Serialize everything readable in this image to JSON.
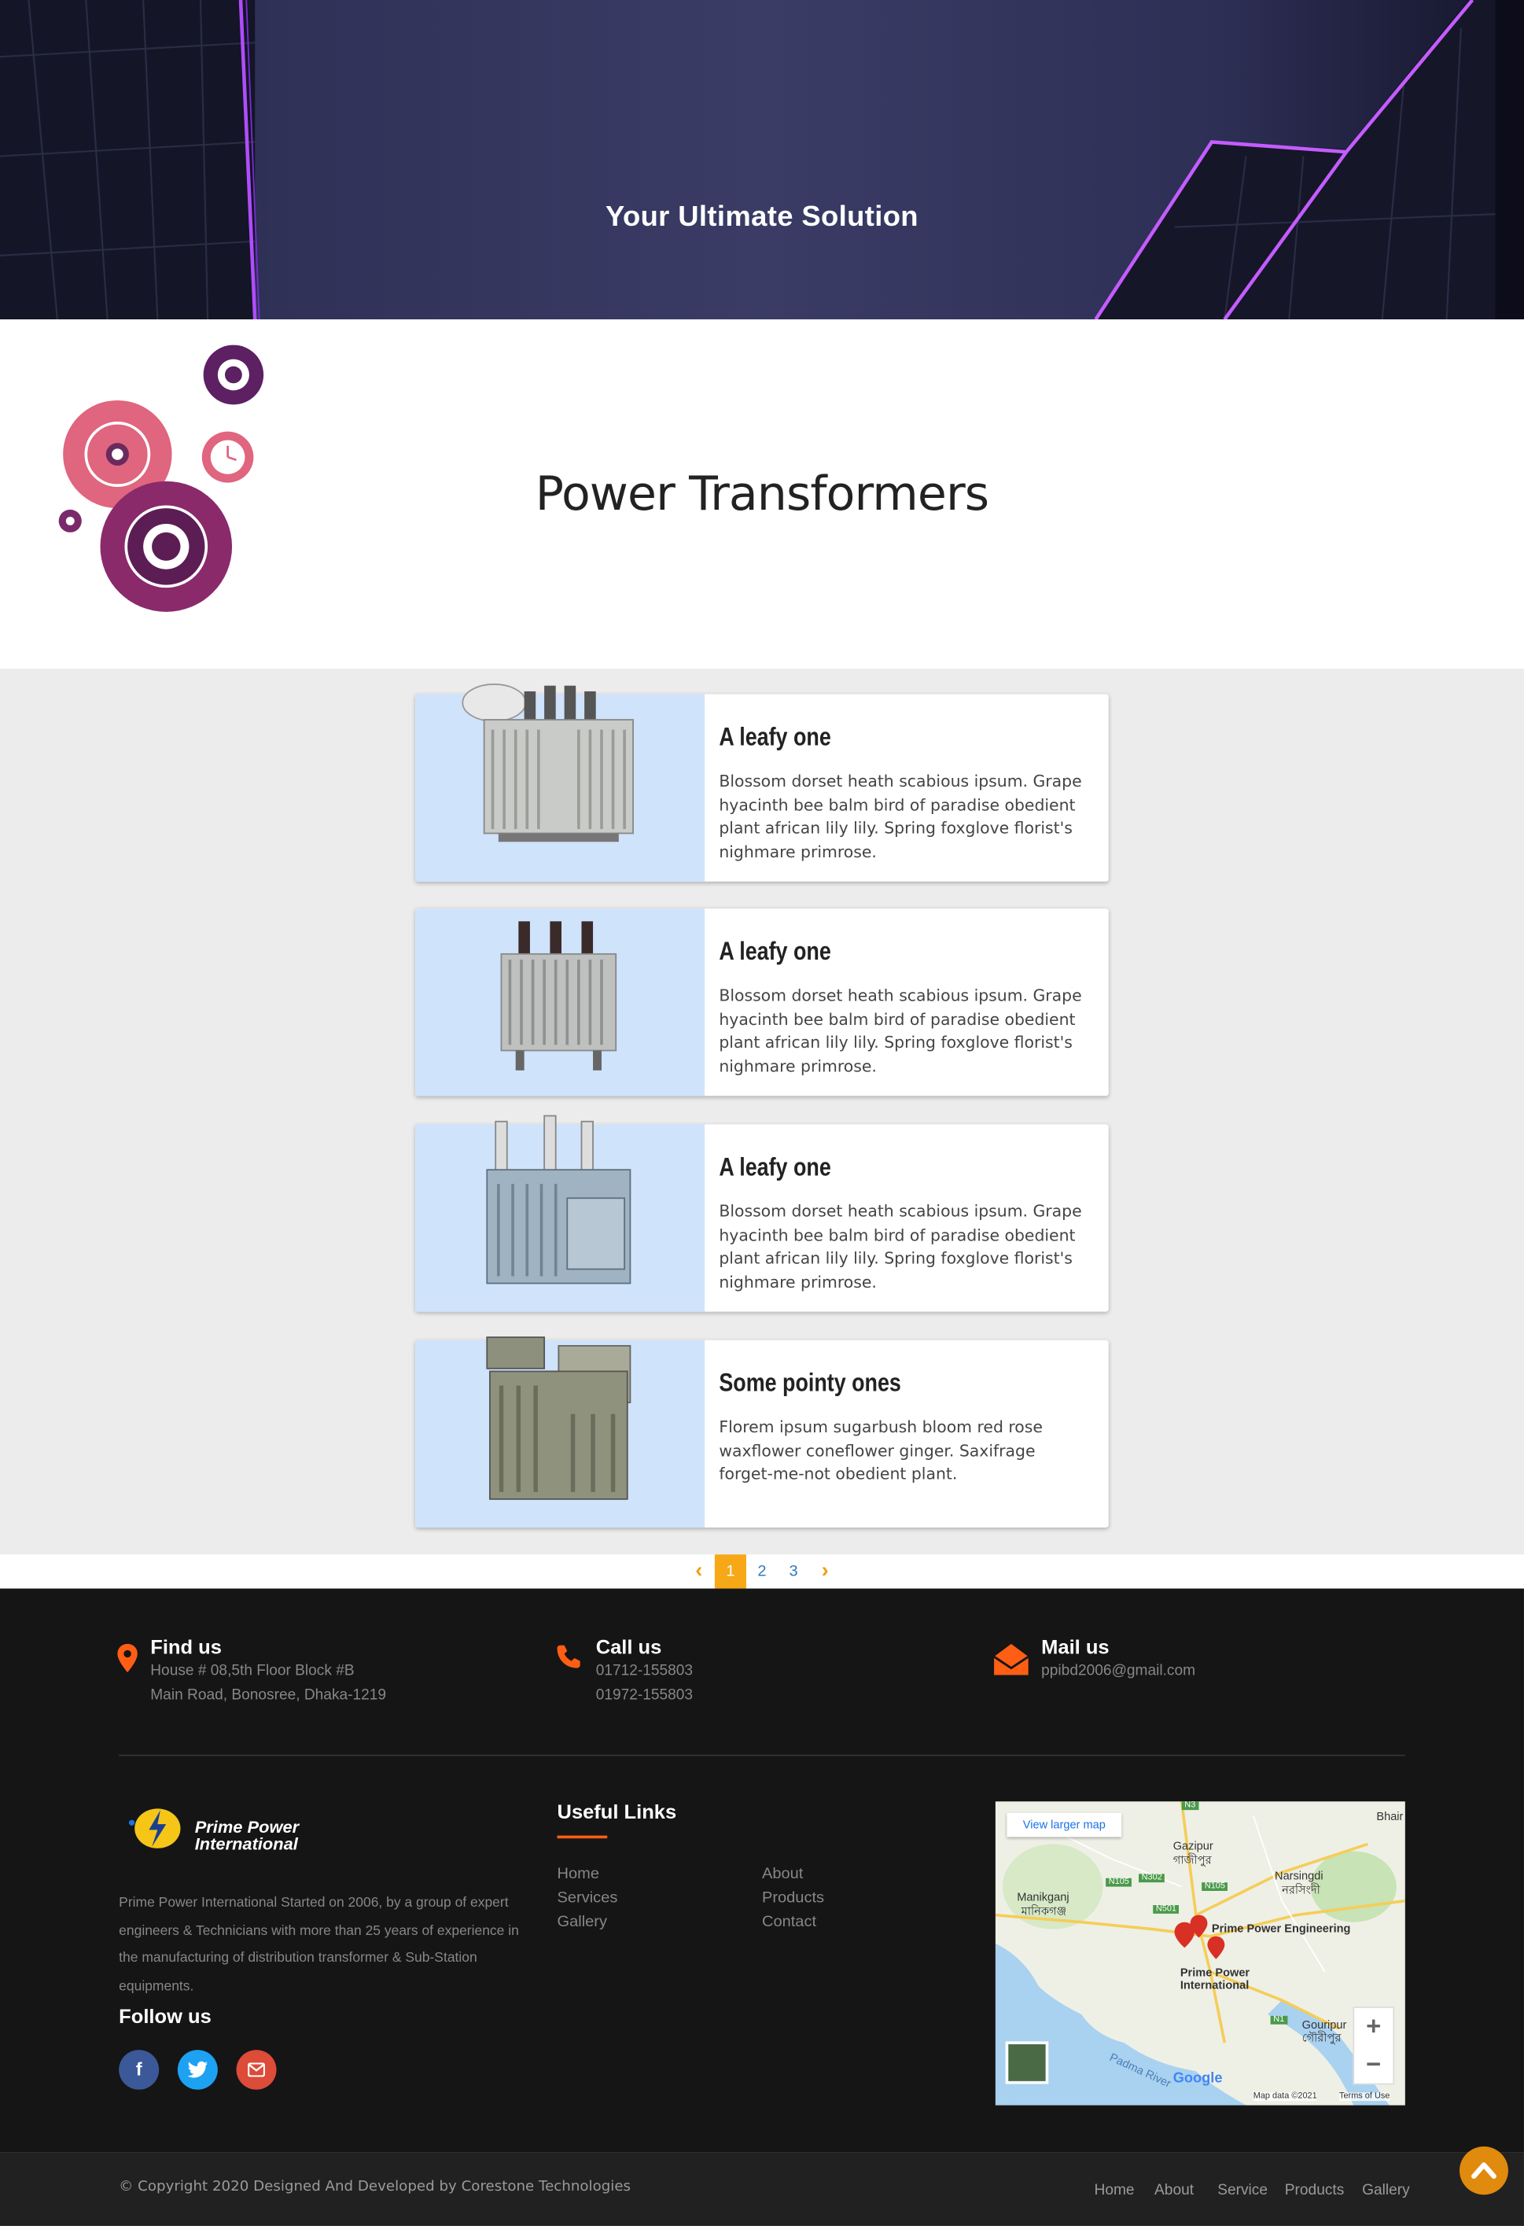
{
  "hero": {
    "title": "Your Ultimate Solution"
  },
  "page": {
    "title": "Power Transformers"
  },
  "products": [
    {
      "title": "A leafy one",
      "text": "Blossom dorset heath scabious ipsum. Grape hyacinth bee balm bird of paradise obedient plant african lily lily. Spring foxglove florist's nighmare primrose."
    },
    {
      "title": "A leafy one",
      "text": "Blossom dorset heath scabious ipsum. Grape hyacinth bee balm bird of paradise obedient plant african lily lily. Spring foxglove florist's nighmare primrose."
    },
    {
      "title": "A leafy one",
      "text": "Blossom dorset heath scabious ipsum. Grape hyacinth bee balm bird of paradise obedient plant african lily lily. Spring foxglove florist's nighmare primrose."
    },
    {
      "title": "Some pointy ones",
      "text": "Florem ipsum sugarbush bloom red rose waxflower coneflower ginger. Saxifrage forget-me-not obedient plant."
    }
  ],
  "pagination": {
    "prev": "‹",
    "pages": [
      "1",
      "2",
      "3"
    ],
    "next": "›",
    "current": "1"
  },
  "contact": {
    "find": {
      "title": "Find us",
      "line1": "House # 08,5th Floor Block #B",
      "line2": "Main Road, Bonosree, Dhaka-1219"
    },
    "call": {
      "title": "Call us",
      "line1": "01712-155803",
      "line2": "01972-155803"
    },
    "mail": {
      "title": "Mail us",
      "line1": "ppibd2006@gmail.com"
    }
  },
  "brand": {
    "logo_line1": "Prime Power",
    "logo_line2": "International",
    "about": "Prime Power International Started on 2006, by a group of expert engineers & Technicians with more than 25 years of experience in the manufacturing of distribution transformer & Sub-Station equipments."
  },
  "follow": {
    "title": "Follow us",
    "icons": [
      "facebook-icon",
      "twitter-icon",
      "envelope-icon"
    ]
  },
  "useful_links": {
    "title": "Useful Links",
    "col1": [
      "Home",
      "Services",
      "Gallery"
    ],
    "col2": [
      "About",
      "Products",
      "Contact"
    ]
  },
  "map": {
    "view_larger": "View larger map",
    "places": [
      "Gazipur",
      "গাজীপুর",
      "Narsingdi",
      "নরসিংদী",
      "Manikganj",
      "মানিকগঞ্জ",
      "Prime Power Engineering",
      "Prime Power",
      "International",
      "Gouripur",
      "গৌরীপুর",
      "Padma River",
      "Bhair"
    ],
    "roads": [
      "N3",
      "N302",
      "N105",
      "N5",
      "N501",
      "N1",
      "N4"
    ],
    "attribution": "Map data ©2021",
    "terms": "Terms of Use",
    "provider": "Google",
    "zoom_in": "+",
    "zoom_out": "−"
  },
  "bottom": {
    "copyright": "© Copyright 2020 Designed And Developed by Corestone Technologies",
    "links": [
      "Home",
      "About",
      "Service",
      "Products",
      "Gallery"
    ]
  },
  "colors": {
    "accent": "#f39c12",
    "orange": "#ff5e14",
    "footer_bg": "#151515",
    "bottom_bg": "#212121",
    "card_img_bg": "#cfe3fb"
  }
}
